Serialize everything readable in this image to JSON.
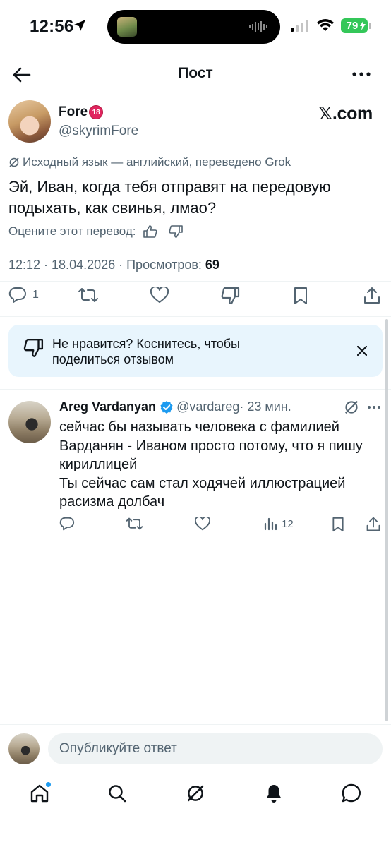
{
  "status_bar": {
    "time": "12:56",
    "battery": "79"
  },
  "header": {
    "title": "Пост"
  },
  "post": {
    "author_name": "Fore",
    "badge": "18",
    "author_handle": "@skyrimFore",
    "source_site": "𝕏.com",
    "translation_note": "Исходный язык — английский, переведено Grok",
    "text": "Эй, Иван, когда тебя отправят на передовую подыхать, как свинья, лмао?",
    "rate_prompt": "Оцените этот перевод:",
    "timestamp": "12:12 · 18.04.2026 · Просмотров: ",
    "views": "69",
    "reply_count": "1"
  },
  "feedback_banner": {
    "text": "Не нравится? Коснитесь, чтобы поделиться отзывом"
  },
  "reply": {
    "author_name": "Areg Vardanyan",
    "handle": "@vardareg",
    "time": " · 23 мин.",
    "text": "сейчас бы называть человека с фамилией Варданян - Иваном просто потому, что я пишу кириллицей\nТы сейчас сам стал ходячей иллюстрацией расизма долбач",
    "views": "12"
  },
  "composer": {
    "placeholder": "Опубликуйте ответ"
  },
  "colors": {
    "accent": "#1d9bf0",
    "text": "#0f1419",
    "muted": "#536471",
    "banner_bg": "#e8f5fd",
    "badge": "#e0245e"
  },
  "icons": [
    "back-arrow-icon",
    "more-icon",
    "grok-icon",
    "thumb-up-icon",
    "thumb-down-icon",
    "reply-icon",
    "repost-icon",
    "like-icon",
    "bookmark-icon",
    "share-icon",
    "close-icon",
    "verified-icon",
    "views-icon",
    "home-icon",
    "search-icon",
    "bell-icon",
    "messages-icon"
  ]
}
